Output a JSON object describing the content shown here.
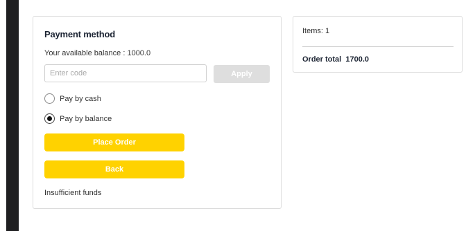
{
  "payment": {
    "title": "Payment method",
    "balance_text": "Your available balance : 1000.0",
    "code_placeholder": "Enter code",
    "code_value": "",
    "apply_label": "Apply",
    "options": [
      {
        "label": "Pay by cash",
        "selected": false
      },
      {
        "label": "Pay by balance",
        "selected": true
      }
    ],
    "place_order_label": "Place Order",
    "back_label": "Back",
    "error_text": "Insufficient funds"
  },
  "summary": {
    "items_text": "Items:  1",
    "total_label": "Order total",
    "total_value": "1700.0"
  },
  "colors": {
    "accent": "#ffd200",
    "disabled": "#dedede",
    "sidebar": "#1f1f21"
  }
}
